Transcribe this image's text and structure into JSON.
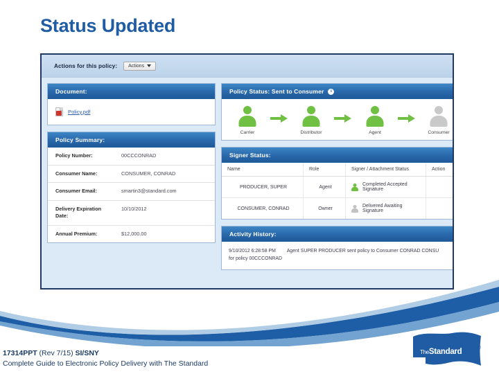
{
  "slide": {
    "title": "Status Updated"
  },
  "colors": {
    "title_blue": "#1f5ca4",
    "panel_header_blue": "#2a69ab",
    "frame_navy": "#1f3864",
    "status_green": "#6fc043",
    "status_gray": "#c9c9c9",
    "link_blue": "#2a5db0"
  },
  "screenshot": {
    "actions_bar": {
      "label": "Actions for this policy:",
      "button_label": "Actions",
      "caret_icon": "chevron-down-icon"
    },
    "document_panel": {
      "header": "Document:",
      "file_icon": "pdf-file-icon",
      "file_link": "Policy.pdf"
    },
    "policy_summary_panel": {
      "header": "Policy Summary:",
      "rows": [
        {
          "label": "Policy Number:",
          "value": "00CCCONRAD"
        },
        {
          "label": "Consumer Name:",
          "value": "CONSUMER, CONRAD"
        },
        {
          "label": "Consumer Email:",
          "value": "smartin3@standard.com"
        },
        {
          "label": "Delivery Expiration Date:",
          "value": "10/10/2012"
        },
        {
          "label": "Annual Premium:",
          "value": "$12,000.00"
        }
      ]
    },
    "policy_status_panel": {
      "header": "Policy Status: Sent to Consumer",
      "info_icon": "info-icon",
      "info_glyph": "i",
      "flow": [
        {
          "label": "Carrier",
          "state": "green"
        },
        {
          "label": "Distributor",
          "state": "green"
        },
        {
          "label": "Agent",
          "state": "green"
        },
        {
          "label": "Consumer",
          "state": "gray"
        }
      ]
    },
    "signer_status_panel": {
      "header": "Signer Status:",
      "columns": [
        "Name",
        "Role",
        "Signer / Attachment Status",
        "Action"
      ],
      "rows": [
        {
          "name": "PRODUCER, SUPER",
          "role": "Agent",
          "status": "Completed Accepted Signature",
          "status_state": "green",
          "action": ""
        },
        {
          "name": "CONSUMER, CONRAD",
          "role": "Owner",
          "status": "Delivered Awaiting Signature",
          "status_state": "gray",
          "action": ""
        }
      ]
    },
    "activity_history_panel": {
      "header": "Activity History:",
      "timestamp": "9/10/2012 6:28:58 PM",
      "entry_line1": "Agent SUPER PRODUCER sent policy to Consumer CONRAD CONSU",
      "entry_line2": "for policy 00CCCONRAD"
    }
  },
  "footer": {
    "code": "17314PPT",
    "revision": " (Rev 7/15) ",
    "states": "SI/SNY",
    "subtitle": "Complete Guide to Electronic Policy Delivery with The Standard",
    "logo_prefix": "The",
    "logo_name": "Standard",
    "logo_mark": "®"
  }
}
